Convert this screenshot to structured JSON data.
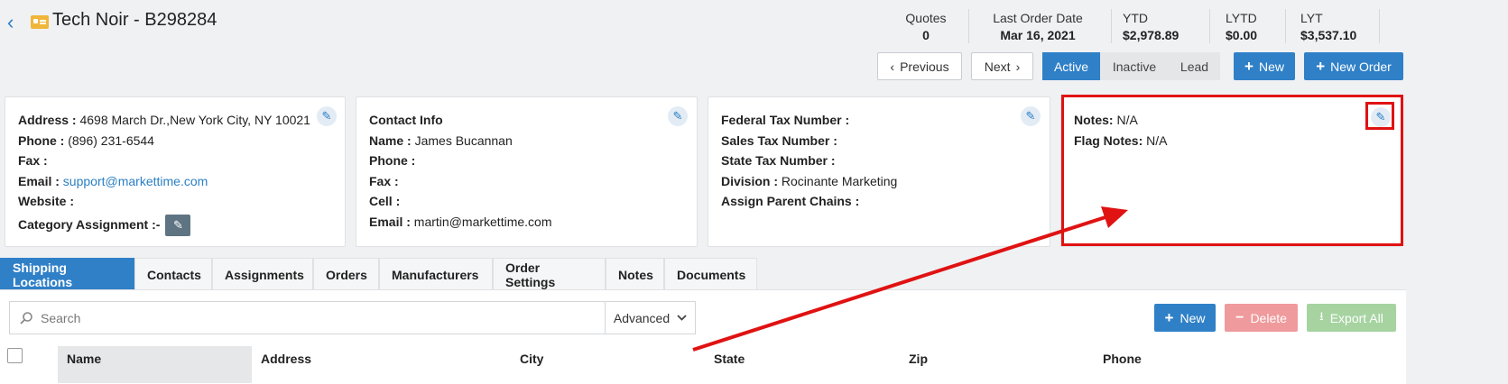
{
  "header": {
    "title": "Tech Noir - B298284",
    "stats": [
      {
        "label": "Quotes",
        "value": "0"
      },
      {
        "label": "Last Order Date",
        "value": "Mar 16, 2021"
      },
      {
        "label": "YTD",
        "value": "$2,978.89"
      },
      {
        "label": "LYTD",
        "value": "$0.00"
      },
      {
        "label": "LYT",
        "value": "$3,537.10"
      }
    ],
    "previous_label": "Previous",
    "next_label": "Next",
    "status_options": [
      "Active",
      "Inactive",
      "Lead"
    ],
    "new_label": "New",
    "new_order_label": "New Order"
  },
  "address_card": {
    "address_label": "Address :",
    "address_value": "4698 March Dr.,New York City, NY 10021",
    "phone_label": "Phone :",
    "phone_value": "(896) 231-6544",
    "fax_label": "Fax :",
    "email_label": "Email :",
    "email_value": "support@markettime.com",
    "website_label": "Website :",
    "category_label": "Category Assignment :-"
  },
  "contact_card": {
    "heading": "Contact Info",
    "name_label": "Name :",
    "name_value": "James Bucannan",
    "phone_label": "Phone :",
    "fax_label": "Fax :",
    "cell_label": "Cell :",
    "email_label": "Email :",
    "email_value": "martin@markettime.com"
  },
  "tax_card": {
    "federal_label": "Federal Tax Number :",
    "sales_label": "Sales Tax Number :",
    "state_label": "State Tax Number :",
    "division_label": "Division :",
    "division_value": "Rocinante Marketing",
    "parent_label": "Assign Parent Chains :"
  },
  "notes_card": {
    "notes_label": "Notes:",
    "notes_value": "N/A",
    "flag_label": "Flag Notes:",
    "flag_value": "N/A"
  },
  "tabs": [
    "Shipping Locations",
    "Contacts",
    "Assignments",
    "Orders",
    "Manufacturers",
    "Order Settings",
    "Notes",
    "Documents"
  ],
  "toolbar": {
    "search_placeholder": "Search",
    "advanced_label": "Advanced",
    "new_label": "New",
    "delete_label": "Delete",
    "export_label": "Export All"
  },
  "table": {
    "columns": [
      "Name",
      "Address",
      "City",
      "State",
      "Zip",
      "Phone"
    ]
  },
  "colors": {
    "primary": "#2f80c7",
    "delete": "#ef9a9c",
    "export": "#a6d3a0",
    "annotation": "#e01212"
  }
}
